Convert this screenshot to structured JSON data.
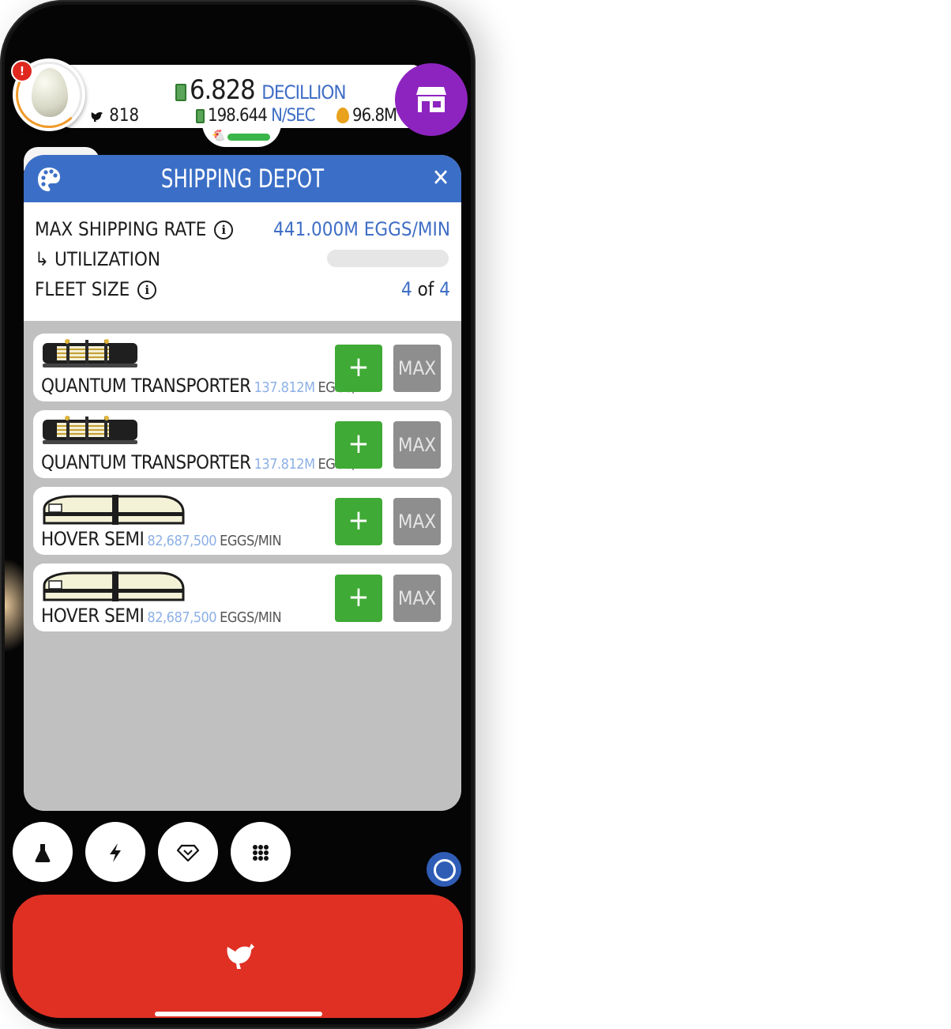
{
  "header": {
    "notification_badge": "!",
    "money_amount": "6.828",
    "money_unit": "DECILLION",
    "income_amount": "198.644",
    "income_unit": "N/SEC",
    "chicken_count": "818",
    "golden_eggs": "96.8M"
  },
  "modal": {
    "title": "SHIPPING DEPOT",
    "max_rate_label": "MAX SHIPPING RATE",
    "max_rate_value": "441.000M EGGS/MIN",
    "utilization_label": "↳ UTILIZATION",
    "utilization_fraction": 0,
    "fleet_label": "FLEET SIZE",
    "fleet_current": "4",
    "fleet_of": "of",
    "fleet_total": "4",
    "vehicles": [
      {
        "name": "QUANTUM TRANSPORTER",
        "rate": "137.812M",
        "unit": "EGGS/MIN",
        "kind": "quantum"
      },
      {
        "name": "QUANTUM TRANSPORTER",
        "rate": "137.812M",
        "unit": "EGGS/MIN",
        "kind": "quantum"
      },
      {
        "name": "HOVER SEMI",
        "rate": "82,687,500",
        "unit": "EGGS/MIN",
        "kind": "hover"
      },
      {
        "name": "HOVER SEMI",
        "rate": "82,687,500",
        "unit": "EGGS/MIN",
        "kind": "hover"
      }
    ],
    "plus_label": "+",
    "max_label": "MAX"
  },
  "icons": {
    "shop": "shop-icon",
    "palette": "palette-icon",
    "close": "close-icon",
    "research": "flask-icon",
    "boost": "lightning-icon",
    "gem": "gem-icon",
    "menu": "grid-icon",
    "chicken": "chicken-icon"
  },
  "colors": {
    "header_blue": "#3b6fc7",
    "accent_blue": "#3f6ec5",
    "shop_purple": "#8e24c0",
    "hatch_red": "#e03024",
    "plus_green": "#3faa35",
    "max_gray": "#8e8e8e"
  }
}
